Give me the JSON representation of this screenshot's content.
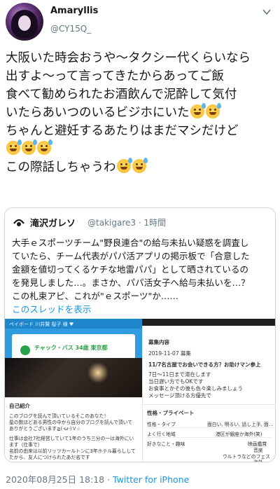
{
  "author": {
    "display_name": "Amaryllis",
    "handle": "@CY15Q_"
  },
  "tweet": {
    "lines": [
      "大阪いた時会おうや〜タクシー代くらいなら",
      "出すよ〜って言ってきたからあってご飯",
      "食べて勧められたお酒飲んで泥酔して気付",
      "いたらあいつのいるビジホにいた",
      "ちゃんと避妊するあたりはまだマシだけど",
      "",
      "この際話しちゃうわ"
    ],
    "emoji_name": "sweat-smile-emoji"
  },
  "quoted_tweet": {
    "author_name": "滝沢ガレソ",
    "author_handle": "@takigare3 · 1時間",
    "lines": [
      "大手ｅスポーツチーム\"野良連合\"の給与未払い疑惑を調査し",
      "ていたら、チーム代表がパパ活アプリの掲示板で「合意した",
      "金額を値切ってくるケチな地雷パパ」として晒されているの",
      "を発見しました…。まさか、パパ活女子へ給与未払いを…？",
      "この札束アピ、これが\"ｅスポーツ\"か……"
    ],
    "thread_link": "このスレッドを表示",
    "media": {
      "app_bar": "ペイボード  川井賢  桜子 様  ♥",
      "profile_name": "チャック・バス  34歳  東京都",
      "profile_sub": "チャック・バス",
      "post_header": "募集内容",
      "post_date": "2019-11-07 募集",
      "post_title": "11/7名古屋でお会いできる方？お助けマン参上",
      "post_lines": [
        "7日〜11日まで滞在します",
        "当日遅い方でもOKです",
        "お食事とかその後も色々楽しみましょう",
        "メッセージ頂ける方優先で"
      ],
      "intro_header": "自己紹介",
      "intro_lines": [
        "このブログを読んで頂いているそこのあなた！",
        "星の数ほどある男性の中から自分のブログを読んで頂いて",
        "ありがとうございます≧(-ω-)Ｖ☆",
        "",
        "仕事は会社7社経営していて1年のうち三分の一は海外にい",
        "ます（仕事で）",
        "名前の由来は以前リッツカールトンに3年ホテル暮らしして",
        "たから、友人につけられたあだ名です"
      ],
      "traits_header": "性格・プライベート",
      "traits": [
        {
          "key": "性格・タイプ",
          "value": "面白い, 明るい, 話し上手, 面…"
        },
        {
          "key": "よく行く地域",
          "value": "港区が銀座か海外(笑)"
        },
        {
          "key": "好きなこと・趣味",
          "value": "映画鑑賞"
        },
        {
          "key": "",
          "value": "音楽"
        },
        {
          "key": "",
          "value": "ウルトラなどのフェス"
        },
        {
          "key": "",
          "value": "海外"
        }
      ]
    }
  },
  "footer": {
    "timestamp": "2020年08月25日 18:18 · ",
    "source": "Twitter for iPhone"
  },
  "colors": {
    "link": "#1b95e0",
    "muted": "#657786",
    "border": "#ccd6dd"
  }
}
